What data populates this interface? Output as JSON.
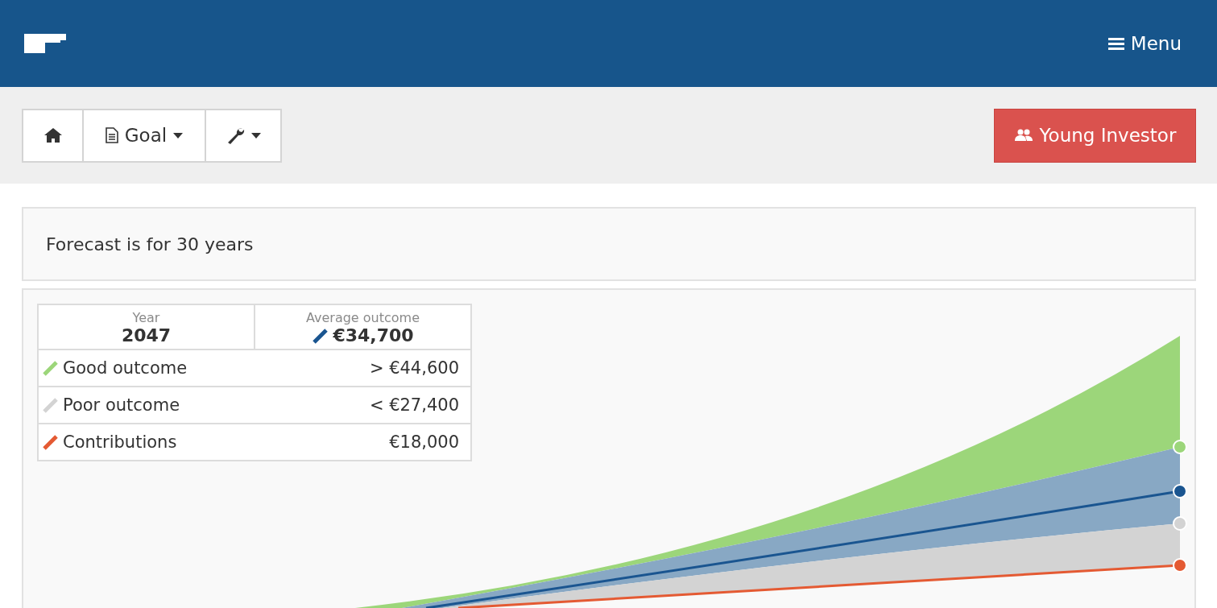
{
  "header": {
    "menu_label": "Menu"
  },
  "toolbar": {
    "goal_label": "Goal"
  },
  "profile_button": {
    "label": "Young Investor"
  },
  "forecast_note": "Forecast is for 30 years",
  "legend": {
    "year_label": "Year",
    "year": "2047",
    "rows": [
      {
        "kind": "average",
        "label": "Average outcome",
        "value": "€34,700",
        "color": "#1a5590"
      },
      {
        "kind": "row",
        "label": "Good outcome",
        "value": "> €44,600",
        "color": "#9cd67a"
      },
      {
        "kind": "row",
        "label": "Poor outcome",
        "value": "< €27,400",
        "color": "#d3d3d3"
      },
      {
        "kind": "row",
        "label": "Contributions",
        "value": "€18,000",
        "color": "#e45a33"
      }
    ]
  }
}
